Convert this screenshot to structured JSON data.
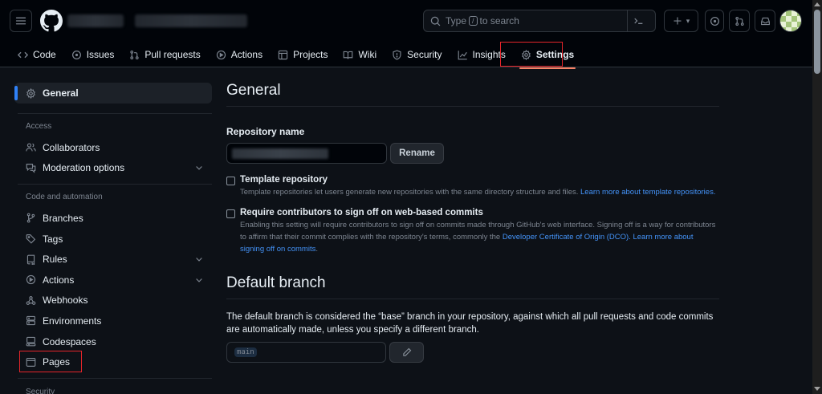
{
  "header": {
    "search_placeholder_pre": "Type",
    "search_key": "/",
    "search_placeholder_post": "to search",
    "plus_caret": "▾"
  },
  "repo_nav": {
    "items": [
      {
        "label": "Code",
        "icon": "code-icon"
      },
      {
        "label": "Issues",
        "icon": "issue-opened-icon"
      },
      {
        "label": "Pull requests",
        "icon": "git-pull-request-icon"
      },
      {
        "label": "Actions",
        "icon": "play-icon"
      },
      {
        "label": "Projects",
        "icon": "table-icon"
      },
      {
        "label": "Wiki",
        "icon": "book-icon"
      },
      {
        "label": "Security",
        "icon": "shield-icon"
      },
      {
        "label": "Insights",
        "icon": "graph-icon"
      },
      {
        "label": "Settings",
        "icon": "gear-icon"
      }
    ],
    "active": "Settings"
  },
  "sidebar": {
    "general": "General",
    "access_heading": "Access",
    "collaborators": "Collaborators",
    "moderation": "Moderation options",
    "code_heading": "Code and automation",
    "branches": "Branches",
    "tags": "Tags",
    "rules": "Rules",
    "actions": "Actions",
    "webhooks": "Webhooks",
    "environments": "Environments",
    "codespaces": "Codespaces",
    "pages": "Pages",
    "security_heading": "Security"
  },
  "main": {
    "general_title": "General",
    "repo_name_label": "Repository name",
    "rename_button": "Rename",
    "template_title": "Template repository",
    "template_hint": "Template repositories let users generate new repositories with the same directory structure and files.",
    "template_link": "Learn more about template repositories.",
    "signoff_title": "Require contributors to sign off on web-based commits",
    "signoff_hint_1": "Enabling this setting will require contributors to sign off on commits made through GitHub's web interface. Signing off is a way for contributors to affirm that their commit complies with the repository's terms, commonly the",
    "signoff_link_1": "Developer Certificate of Origin (DCO).",
    "signoff_link_2": "Learn more about signing off on commits",
    "signoff_period": ".",
    "default_branch_title": "Default branch",
    "default_branch_text": "The default branch is considered the “base” branch in your repository, against which all pull requests and code commits are automatically made, unless you specify a different branch.",
    "default_branch_value": "main"
  },
  "colors": {
    "background": "#0d1117",
    "header": "#010409",
    "link": "#4493f8",
    "accent_blue": "#2f81f7",
    "underline": "#f78166",
    "highlight_box": "#e5252a"
  }
}
